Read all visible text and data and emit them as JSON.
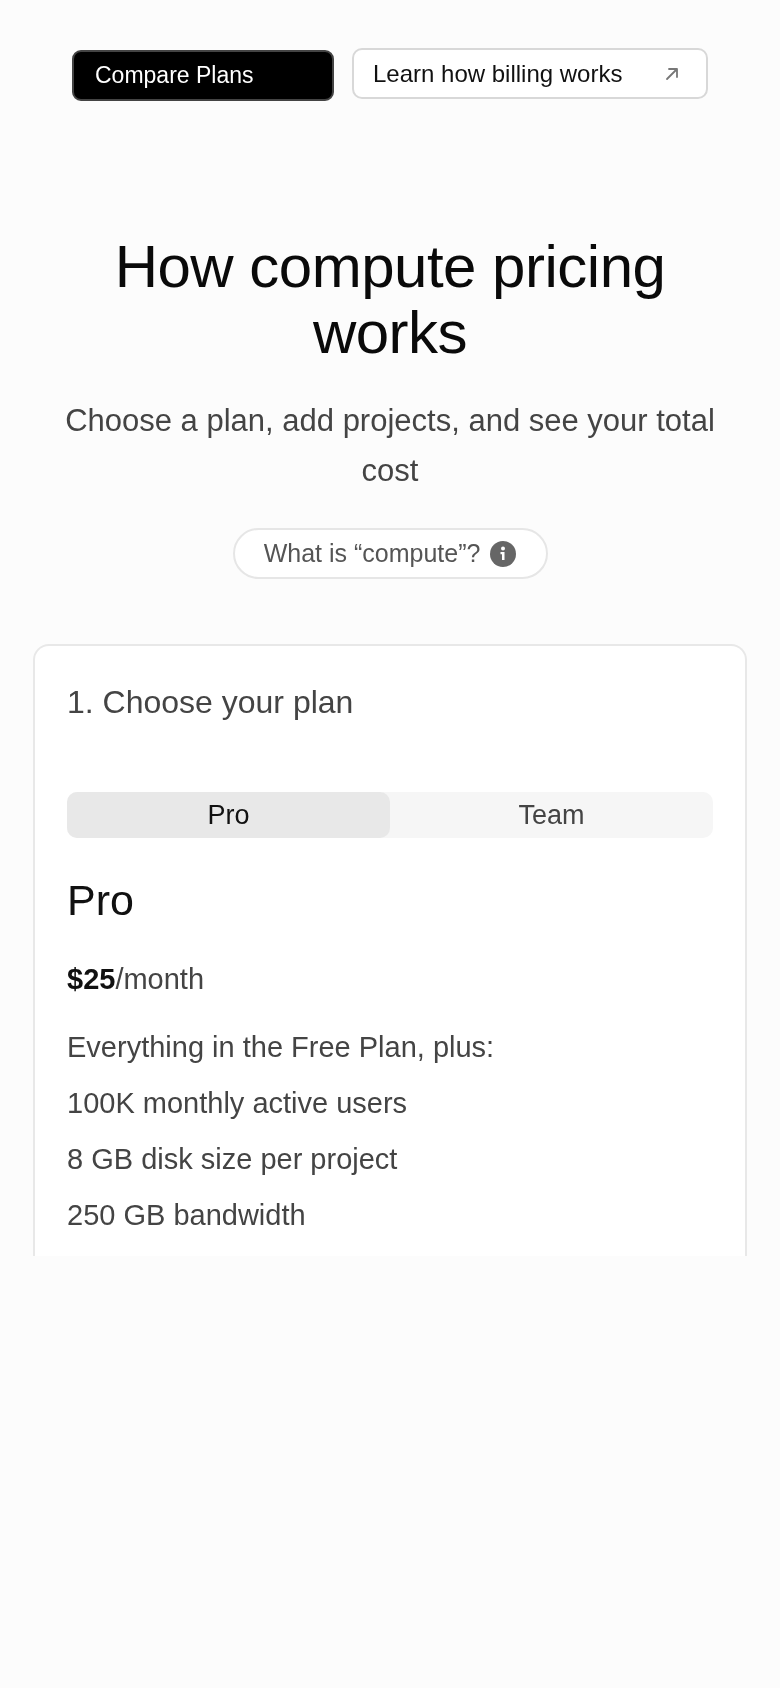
{
  "top_buttons": [
    {
      "label": "Compare Plans",
      "kind": "primary"
    },
    {
      "label": "Learn how billing works",
      "kind": "external"
    }
  ],
  "heading": "How compute pricing works",
  "subtitle": "Choose a plan, add projects, and see your total cost",
  "info_pill": {
    "label": "What is “compute”?"
  },
  "plan_card": {
    "step_title": "1. Choose your plan",
    "tabs": [
      {
        "label": "Pro",
        "selected": true
      },
      {
        "label": "Team",
        "selected": false
      }
    ],
    "plan_name": "Pro",
    "price": "**$25**/month",
    "features": [
      "Everything in the Free Plan, plus:",
      "100K monthly active users",
      "8 GB disk size per project",
      "250 GB bandwidth"
    ]
  }
}
